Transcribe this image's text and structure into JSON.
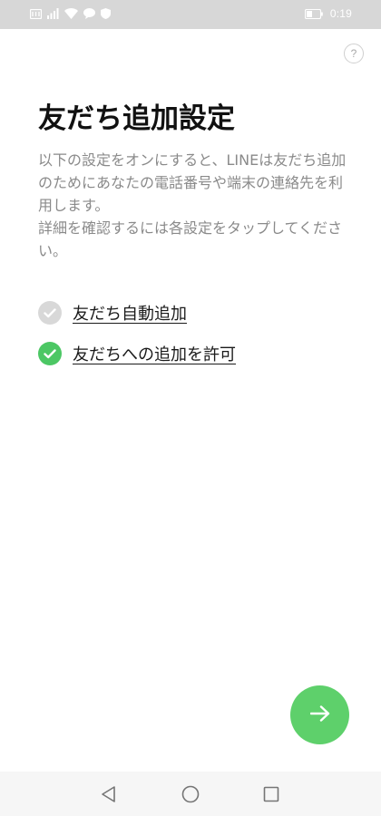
{
  "status_bar": {
    "time": "0:19",
    "icons": [
      "notification-icon",
      "signal-icon",
      "wifi-icon",
      "chat-bubble-icon",
      "shield-icon",
      "battery-icon"
    ]
  },
  "help": {
    "label": "?"
  },
  "title": "友だち追加設定",
  "description": {
    "line1": "以下の設定をオンにすると、LINEは友だち追加のためにあなたの電話番号や端末の連絡先を利用します。",
    "line2": "詳細を確認するには各設定をタップしてください。"
  },
  "settings": [
    {
      "label": "友だち自動追加",
      "enabled": false,
      "icon": "check-circle-icon"
    },
    {
      "label": "友だちへの追加を許可",
      "enabled": true,
      "icon": "check-circle-icon"
    }
  ],
  "next_button": {
    "icon": "arrow-right-icon"
  },
  "colors": {
    "accent": "#4cc764",
    "fab": "#5ed06b",
    "status_bar": "#d7d7d7",
    "disabled_check": "#d8d8d8",
    "description_text": "#8a8a8a"
  },
  "navigation": {
    "icons": [
      "back-triangle-icon",
      "home-circle-icon",
      "recents-square-icon"
    ]
  }
}
